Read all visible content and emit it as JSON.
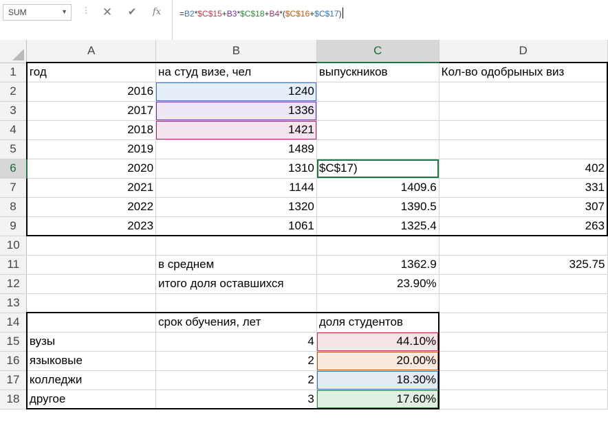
{
  "formula_bar": {
    "name_box": "SUM",
    "dropdown_icon": "chevron-down-icon",
    "cancel_icon": "✕",
    "enter_icon": "✔",
    "fx_label": "fx",
    "formula_parts": [
      {
        "text": "=",
        "ref": ""
      },
      {
        "text": "B2",
        "ref": "b2"
      },
      {
        "text": "*",
        "ref": ""
      },
      {
        "text": "$C$15",
        "ref": "c15"
      },
      {
        "text": "+",
        "ref": ""
      },
      {
        "text": "B3",
        "ref": "b3"
      },
      {
        "text": "*",
        "ref": ""
      },
      {
        "text": "$C$18",
        "ref": "c18"
      },
      {
        "text": "+",
        "ref": ""
      },
      {
        "text": "B4",
        "ref": "b4"
      },
      {
        "text": "*(",
        "ref": ""
      },
      {
        "text": "$C$16",
        "ref": "c16"
      },
      {
        "text": "+",
        "ref": ""
      },
      {
        "text": "$C$17",
        "ref": "c17"
      },
      {
        "text": ")",
        "ref": ""
      }
    ]
  },
  "ref_colors": {
    "b2": "#4472c4",
    "b3": "#7030a0",
    "b4": "#a03070",
    "c15": "#c0394f",
    "c16": "#c55a11",
    "c17": "#2e75b6",
    "c18": "#2e8b3e"
  },
  "accent_color": "#217346",
  "columns": [
    "A",
    "B",
    "C",
    "D"
  ],
  "active_column": "C",
  "active_row": 6,
  "rows": [
    {
      "n": "1",
      "A": "год",
      "B": "на студ визе, чел",
      "C": "выпускников",
      "D": "Кол-во одобрыных виз"
    },
    {
      "n": "2",
      "A": "2016",
      "B": "1240",
      "C": "",
      "D": ""
    },
    {
      "n": "3",
      "A": "2017",
      "B": "1336",
      "C": "",
      "D": ""
    },
    {
      "n": "4",
      "A": "2018",
      "B": "1421",
      "C": "",
      "D": ""
    },
    {
      "n": "5",
      "A": "2019",
      "B": "1489",
      "C": "",
      "D": ""
    },
    {
      "n": "6",
      "A": "2020",
      "B": "1310",
      "C": "$C$17)",
      "D": "402"
    },
    {
      "n": "7",
      "A": "2021",
      "B": "1144",
      "C": "1409.6",
      "D": "331"
    },
    {
      "n": "8",
      "A": "2022",
      "B": "1320",
      "C": "1390.5",
      "D": "307"
    },
    {
      "n": "9",
      "A": "2023",
      "B": "1061",
      "C": "1325.4",
      "D": "263"
    },
    {
      "n": "10",
      "A": "",
      "B": "",
      "C": "",
      "D": ""
    },
    {
      "n": "11",
      "A": "",
      "B": "в среднем",
      "C": "1362.9",
      "D": "325.75"
    },
    {
      "n": "12",
      "A": "",
      "B": "итого доля оставшихся",
      "C": "23.90%",
      "D": ""
    },
    {
      "n": "13",
      "A": "",
      "B": "",
      "C": "",
      "D": ""
    },
    {
      "n": "14",
      "A": "",
      "B": "срок обучения, лет",
      "C": "доля студентов",
      "D": ""
    },
    {
      "n": "15",
      "A": "вузы",
      "B": "4",
      "C": "44.10%",
      "D": ""
    },
    {
      "n": "16",
      "A": "языковые",
      "B": "2",
      "C": "20.00%",
      "D": ""
    },
    {
      "n": "17",
      "A": "колледжи",
      "B": "2",
      "C": "18.30%",
      "D": ""
    },
    {
      "n": "18",
      "A": "другое",
      "B": "3",
      "C": "17.60%",
      "D": ""
    }
  ]
}
